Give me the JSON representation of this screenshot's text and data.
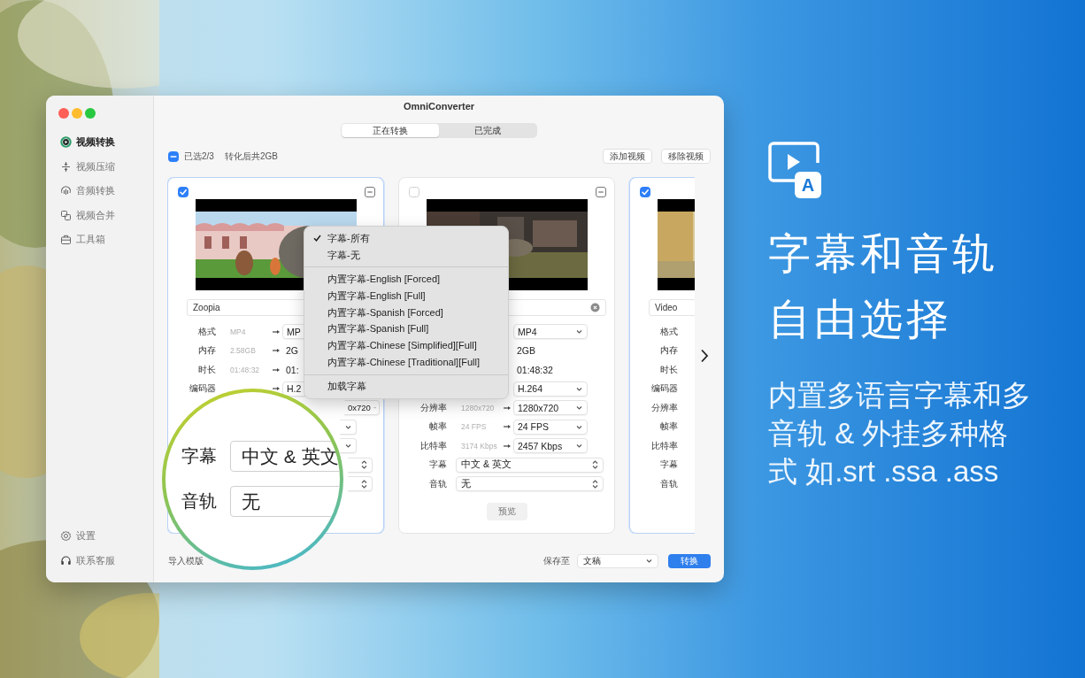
{
  "window": {
    "title": "OmniConverter"
  },
  "sidebar": {
    "items": [
      {
        "label": "视频转换",
        "selected": true
      },
      {
        "label": "视频压缩",
        "selected": false
      },
      {
        "label": "音频转换",
        "selected": false
      },
      {
        "label": "视频合并",
        "selected": false
      },
      {
        "label": "工具箱",
        "selected": false
      }
    ],
    "footer_items": [
      {
        "label": "设置"
      },
      {
        "label": "联系客服"
      }
    ]
  },
  "tabs": [
    {
      "label": "正在转换",
      "selected": true
    },
    {
      "label": "已完成",
      "selected": false
    }
  ],
  "toolbar": {
    "select_all": {
      "checked": true,
      "mixed": true
    },
    "selection": "已选2/3",
    "size": "转化后共2GB",
    "buttons": [
      "添加视频",
      "移除视频"
    ]
  },
  "cards": [
    {
      "checked": true,
      "collapse_button": true,
      "name": "Zoopia",
      "clear_button": false,
      "rows": [
        {
          "kind": "field",
          "label": "格式",
          "source": "MP4",
          "arrow": true,
          "target": "MP"
        },
        {
          "kind": "text",
          "label": "内存",
          "source": "2.58GB",
          "arrow": true,
          "target": "2G"
        },
        {
          "kind": "text",
          "label": "时长",
          "source": "01:48:32",
          "arrow": true,
          "target": "01:"
        },
        {
          "kind": "field",
          "label": "编码器",
          "arrow": true,
          "target": "H.2"
        },
        {
          "kind": "select-tail",
          "arrow": false,
          "target": "0x720"
        },
        {
          "kind": "select-stub",
          "arrow": false
        },
        {
          "kind": "select-stub",
          "arrow": false
        },
        {
          "kind": "stepper-stub",
          "arrow": false
        },
        {
          "kind": "stepper-stub",
          "arrow": false
        }
      ]
    },
    {
      "checked": false,
      "collapse_button": true,
      "clear_button": true,
      "rows": [
        {
          "kind": "select",
          "arrow": false,
          "target": "MP4"
        },
        {
          "kind": "text",
          "arrow": false,
          "target": "2GB"
        },
        {
          "kind": "text",
          "arrow": false,
          "target": "01:48:32"
        },
        {
          "kind": "select",
          "arrow": false,
          "target": "H.264"
        },
        {
          "kind": "select",
          "label": "分辨率",
          "source": "1280x720",
          "arrow": true,
          "target": "1280x720"
        },
        {
          "kind": "select",
          "label": "帧率",
          "source": "24 FPS",
          "arrow": true,
          "target": "24 FPS"
        },
        {
          "kind": "select",
          "label": "比特率",
          "source": "3174 Kbps",
          "arrow": true,
          "target": "2457 Kbps"
        },
        {
          "kind": "stepper",
          "label": "字幕",
          "target": "中文 & 英文",
          "arrow": false
        },
        {
          "kind": "stepper",
          "label": "音轨",
          "target": "无",
          "arrow": false
        }
      ],
      "preview": "预览"
    },
    {
      "checked": true,
      "collapse_button": false,
      "name": "Video",
      "clear_button": false,
      "rows": [
        {
          "kind": "text",
          "label": "格式",
          "arrow": false
        },
        {
          "kind": "text",
          "label": "内存",
          "arrow": false
        },
        {
          "kind": "text",
          "label": "时长",
          "arrow": false
        },
        {
          "kind": "text",
          "label": "编码器",
          "arrow": false
        },
        {
          "kind": "text",
          "label": "分辨率",
          "arrow": false
        },
        {
          "kind": "text",
          "label": "帧率",
          "arrow": false
        },
        {
          "kind": "text",
          "label": "比特率",
          "arrow": false
        },
        {
          "kind": "text",
          "label": "字幕",
          "arrow": false
        },
        {
          "kind": "text",
          "label": "音轨",
          "arrow": false
        }
      ]
    }
  ],
  "menu": {
    "items": [
      {
        "kind": "item",
        "label": "字幕-所有",
        "checked": true
      },
      {
        "kind": "item",
        "label": "字幕-无",
        "checked": false
      },
      {
        "kind": "separator"
      },
      {
        "kind": "item",
        "label": "内置字幕-English [Forced]",
        "checked": false
      },
      {
        "kind": "item",
        "label": "内置字幕-English [Full]",
        "checked": false
      },
      {
        "kind": "item",
        "label": "内置字幕-Spanish [Forced]",
        "checked": false
      },
      {
        "kind": "item",
        "label": "内置字幕-Spanish [Full]",
        "checked": false
      },
      {
        "kind": "item",
        "label": "内置字幕-Chinese [Simplified][Full]",
        "checked": false
      },
      {
        "kind": "item",
        "label": "内置字幕-Chinese [Traditional][Full]",
        "checked": false
      },
      {
        "kind": "separator"
      },
      {
        "kind": "item",
        "label": "加载字幕",
        "checked": false
      }
    ]
  },
  "magnifier": {
    "rows": [
      {
        "label": "字幕",
        "value": "中文 & 英文"
      },
      {
        "label": "音轨",
        "value": "无"
      }
    ]
  },
  "bottom_bar": {
    "template_label": "导入模版",
    "save_label": "保存至",
    "save_value": "文稿",
    "convert_button": "转换"
  },
  "promo": {
    "icon_letter": "A",
    "title_lines": [
      "字幕和音轨",
      "自由选择"
    ],
    "description_lines": [
      "内置多语言字幕和多",
      "音轨 & 外挂多种格",
      "式 如.srt .ssa .ass"
    ]
  }
}
